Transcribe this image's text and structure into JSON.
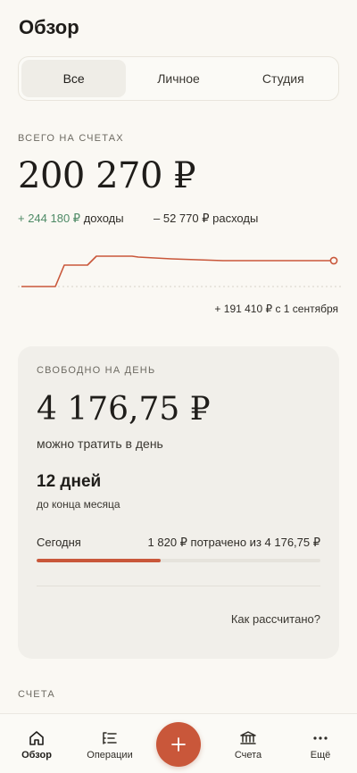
{
  "header": {
    "title": "Обзор"
  },
  "segments": [
    {
      "label": "Все",
      "active": true
    },
    {
      "label": "Личное",
      "active": false
    },
    {
      "label": "Студия",
      "active": false
    }
  ],
  "summary": {
    "label": "ВСЕГО НА СЧЕТАХ",
    "total": "200 270 ₽",
    "income_value": "+ 244 180 ₽",
    "income_label": " доходы",
    "expense_value": "– 52 770 ₽",
    "expense_label": " расходы",
    "since": "+ 191 410 ₽ с 1 сентября"
  },
  "daily": {
    "label": "СВОБОДНО НА ДЕНЬ",
    "amount": "4 176,75 ₽",
    "amount_sub": "можно тратить в день",
    "days": "12 дней",
    "days_sub": "до конца месяца",
    "today_label": "Сегодня",
    "spent": "1 820 ₽ потрачено из 4 176,75 ₽",
    "progress": 0.436,
    "how_link": "Как рассчитано?"
  },
  "accounts": {
    "label": "СЧЕТА"
  },
  "nav": {
    "items": [
      {
        "label": "Обзор",
        "icon": "home-icon",
        "active": true
      },
      {
        "label": "Операции",
        "icon": "list-icon",
        "active": false
      },
      {
        "label": "Счета",
        "icon": "bank-icon",
        "active": false
      },
      {
        "label": "Ещё",
        "icon": "more-icon",
        "active": false
      }
    ],
    "add_icon": "plus-icon"
  },
  "colors": {
    "accent": "#c9573a",
    "income": "#4e8a66",
    "background": "#faf8f3",
    "card": "#f1efea"
  }
}
